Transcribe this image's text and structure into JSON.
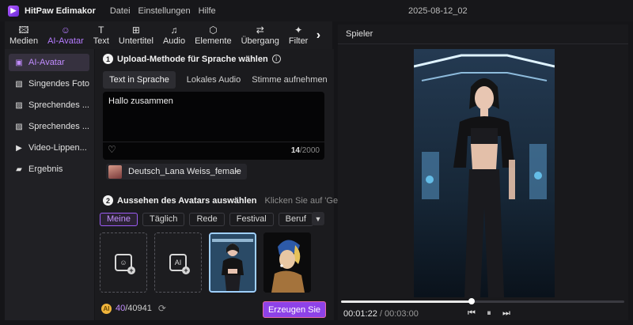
{
  "app": {
    "name": "HitPaw Edimakor",
    "menu": [
      "Datei",
      "Einstellungen",
      "Hilfe"
    ],
    "project_title": "2025-08-12_02"
  },
  "toolbar": {
    "tools": [
      {
        "label": "Medien",
        "icon": "media-icon"
      },
      {
        "label": "AI-Avatar",
        "icon": "ai-avatar-icon",
        "active": true
      },
      {
        "label": "Text",
        "icon": "text-icon"
      },
      {
        "label": "Untertitel",
        "icon": "subtitle-icon"
      },
      {
        "label": "Audio",
        "icon": "audio-icon"
      },
      {
        "label": "Elemente",
        "icon": "elements-icon"
      },
      {
        "label": "Übergang",
        "icon": "transition-icon"
      },
      {
        "label": "Filter",
        "icon": "filter-icon"
      }
    ],
    "more_icon": "chevron-right-icon"
  },
  "sidebar": {
    "items": [
      {
        "label": "AI-Avatar",
        "active": true
      },
      {
        "label": "Singendes Foto"
      },
      {
        "label": "Sprechendes ..."
      },
      {
        "label": "Sprechendes ..."
      },
      {
        "label": "Video-Lippen..."
      },
      {
        "label": "Ergebnis"
      }
    ]
  },
  "upload": {
    "step": "1",
    "title": "Upload-Methode für Sprache wählen",
    "tabs": [
      "Text in Sprache",
      "Lokales Audio",
      "Stimme aufnehmen"
    ],
    "active_tab": 0,
    "text_value": "Hallo zusammen",
    "char_count": "14",
    "char_limit": "/2000",
    "voice": "Deutsch_Lana Weiss_female"
  },
  "appearance": {
    "step": "2",
    "title": "Aussehen des Avatars auswählen",
    "hint": "Klicken Sie auf 'Generieren",
    "categories": [
      "Meine",
      "Täglich",
      "Rede",
      "Festival",
      "Beruf"
    ],
    "active_category": 0
  },
  "footer": {
    "credits_used": "40",
    "credits_total": "/40941",
    "generate_label": "Erzeugen Sie"
  },
  "player": {
    "title": "Spieler",
    "current_time": "00:01:22",
    "separator": " / ",
    "total_time": "00:03:00",
    "progress": 0.46
  },
  "colors": {
    "accent": "#9c5cf5",
    "generate_button": "#8e42e8",
    "background": "#151518"
  }
}
